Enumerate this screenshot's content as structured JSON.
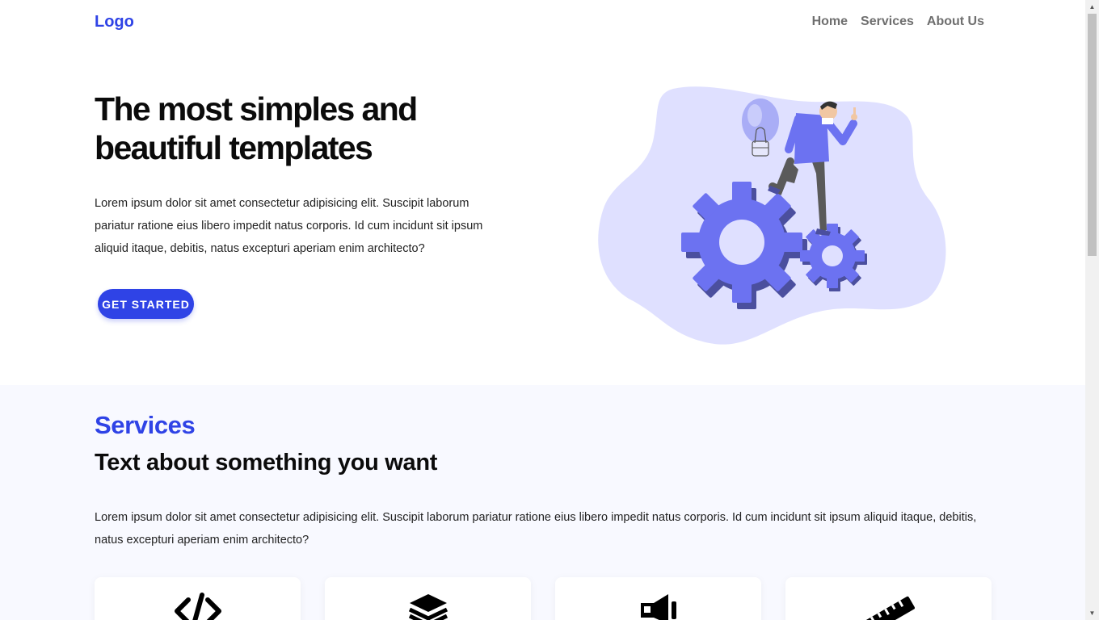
{
  "header": {
    "logo": "Logo",
    "nav": [
      "Home",
      "Services",
      "About Us"
    ]
  },
  "hero": {
    "title": "The most simples and beautiful templates",
    "text": "Lorem ipsum dolor sit amet consectetur adipisicing elit. Suscipit laborum pariatur ratione eius libero impedit natus corporis. Id cum incidunt sit ipsum aliquid itaque, debitis, natus excepturi aperiam enim architecto?",
    "cta": "GET STARTED"
  },
  "services": {
    "title": "Services",
    "subtitle": "Text about something you want",
    "text": "Lorem ipsum dolor sit amet consectetur adipisicing elit. Suscipit laborum pariatur ratione eius libero impedit natus corporis. Id cum incidunt sit ipsum aliquid itaque, debitis, natus excepturi aperiam enim architecto?",
    "cards": [
      {
        "icon": "code-icon"
      },
      {
        "icon": "layers-icon"
      },
      {
        "icon": "megaphone-icon"
      },
      {
        "icon": "ruler-icon"
      }
    ]
  },
  "colors": {
    "accent": "#2f43e6",
    "blob": "#dfe0ff",
    "gear": "#6c72f1",
    "section_bg": "#f8f9ff"
  }
}
